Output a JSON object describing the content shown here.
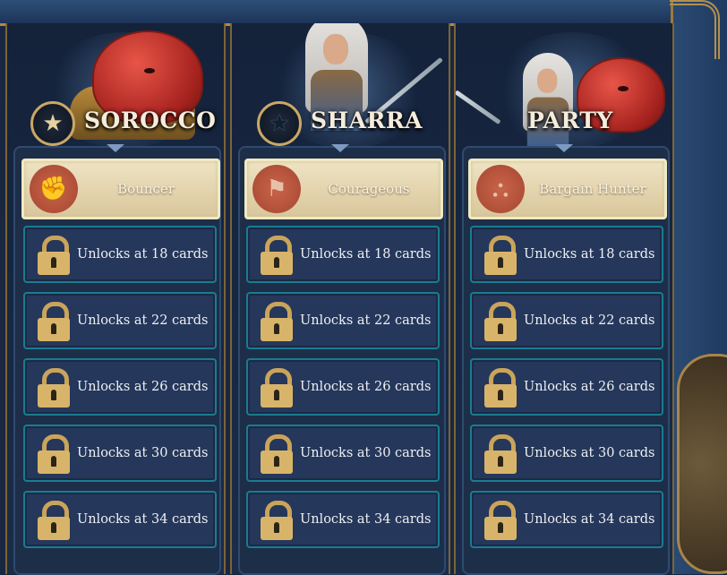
{
  "columns": [
    {
      "title": "SOROCCO",
      "badge_icon": "star-icon",
      "trait": {
        "name": "Bouncer",
        "icon": "bouncer-icon"
      },
      "unlocks": [
        "Unlocks at 18 cards",
        "Unlocks at 22 cards",
        "Unlocks at 26 cards",
        "Unlocks at 30 cards",
        "Unlocks at 34 cards"
      ]
    },
    {
      "title": "SHARRA",
      "badge_icon": "dark-star-icon",
      "trait": {
        "name": "Courageous",
        "icon": "courageous-icon"
      },
      "unlocks": [
        "Unlocks at 18 cards",
        "Unlocks at 22 cards",
        "Unlocks at 26 cards",
        "Unlocks at 30 cards",
        "Unlocks at 34 cards"
      ]
    },
    {
      "title": "PARTY",
      "badge_icon": "",
      "trait": {
        "name": "Bargain Hunter",
        "icon": "bargain-hunter-icon"
      },
      "unlocks": [
        "Unlocks at 18 cards",
        "Unlocks at 22 cards",
        "Unlocks at 26 cards",
        "Unlocks at 30 cards",
        "Unlocks at 34 cards"
      ]
    }
  ],
  "colors": {
    "gold": "#caa45a",
    "trait_bg": "#e6d8b4",
    "trait_icon": "#b8533c",
    "row_bg": "#25375a",
    "row_border": "#1a7b94"
  }
}
